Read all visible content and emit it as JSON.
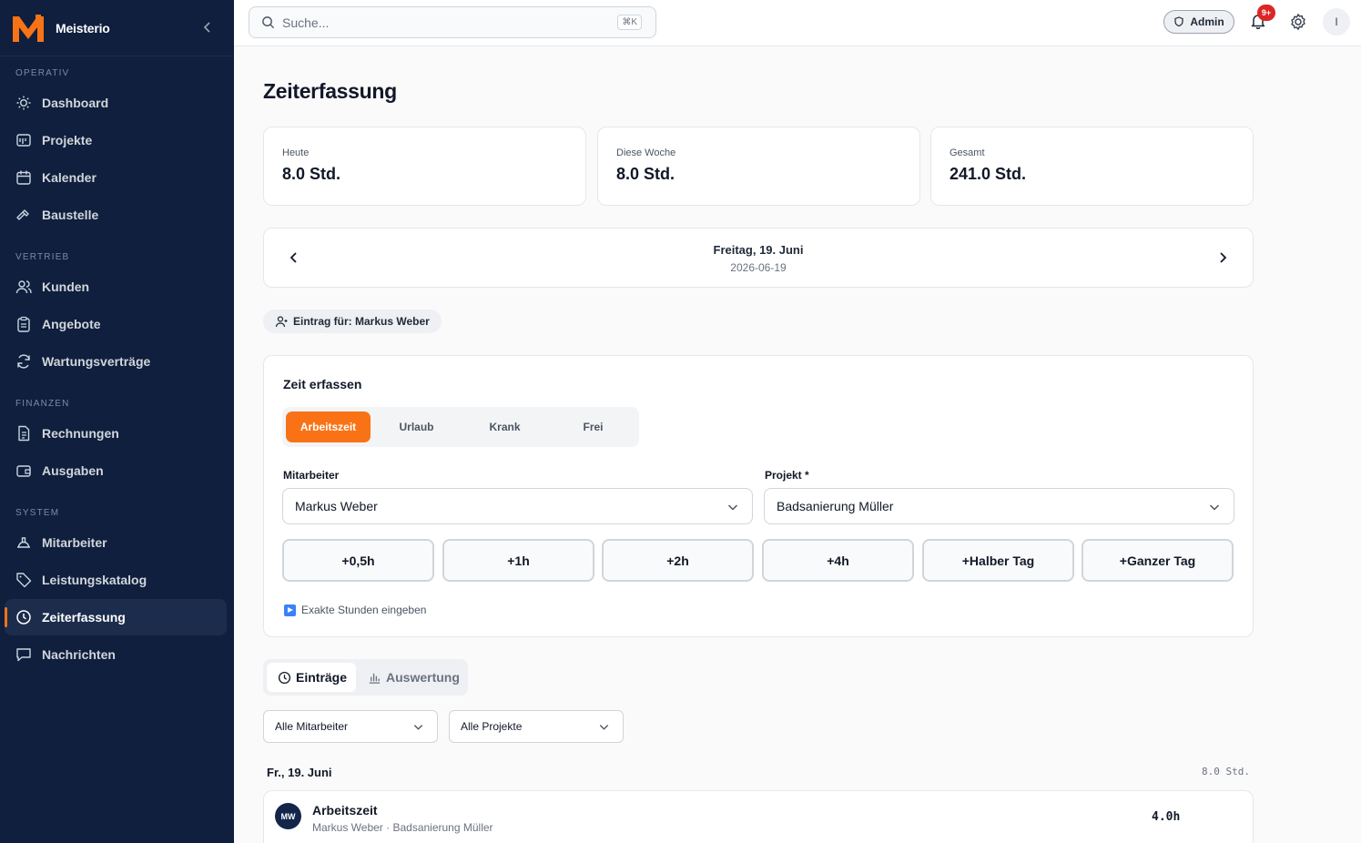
{
  "brand": {
    "name": "Meisterio"
  },
  "sidebar": {
    "sections": [
      "OPERATIV",
      "VERTRIEB",
      "FINANZEN",
      "SYSTEM"
    ],
    "items": [
      {
        "label": "Dashboard",
        "icon": "sun-icon"
      },
      {
        "label": "Projekte",
        "icon": "projects-icon"
      },
      {
        "label": "Kalender",
        "icon": "calendar-icon"
      },
      {
        "label": "Baustelle",
        "icon": "hammer-icon"
      },
      {
        "label": "Kunden",
        "icon": "users-icon"
      },
      {
        "label": "Angebote",
        "icon": "clipboard-icon"
      },
      {
        "label": "Wartungsverträge",
        "icon": "refresh-icon"
      },
      {
        "label": "Rechnungen",
        "icon": "invoice-icon"
      },
      {
        "label": "Ausgaben",
        "icon": "wallet-icon"
      },
      {
        "label": "Mitarbeiter",
        "icon": "hardhat-icon"
      },
      {
        "label": "Leistungskatalog",
        "icon": "tag-icon"
      },
      {
        "label": "Zeiterfassung",
        "icon": "clock-icon",
        "active": true
      },
      {
        "label": "Nachrichten",
        "icon": "message-icon"
      }
    ]
  },
  "topbar": {
    "search_placeholder": "Suche...",
    "shortcut": "⌘K",
    "role": "Admin",
    "notifications": "9+",
    "avatar_initial": "I"
  },
  "page": {
    "title": "Zeiterfassung",
    "stats": [
      {
        "label": "Heute",
        "value": "8.0 Std."
      },
      {
        "label": "Diese Woche",
        "value": "8.0 Std."
      },
      {
        "label": "Gesamt",
        "value": "241.0 Std."
      }
    ],
    "date_nav": {
      "day": "Freitag, 19. Juni",
      "iso": "2026-06-19"
    },
    "entry_for": "Eintrag für: Markus Weber"
  },
  "capture": {
    "title": "Zeit erfassen",
    "types": [
      "Arbeitszeit",
      "Urlaub",
      "Krank",
      "Frei"
    ],
    "active_type": "Arbeitszeit",
    "employee_label": "Mitarbeiter",
    "employee_value": "Markus Weber",
    "project_label": "Projekt *",
    "project_value": "Badsanierung Müller",
    "quick_buttons": [
      "+0,5h",
      "+1h",
      "+2h",
      "+4h",
      "+Halber Tag",
      "+Ganzer Tag"
    ],
    "exact_link": "Exakte Stunden eingeben"
  },
  "list": {
    "tabs": [
      "Einträge",
      "Auswertung"
    ],
    "filters": [
      "Alle Mitarbeiter",
      "Alle Projekte"
    ],
    "group_date": "Fr., 19. Juni",
    "group_total": "8.0 Std.",
    "entries": [
      {
        "initials": "MW",
        "title": "Arbeitszeit",
        "subtitle": "Markus Weber · Badsanierung Müller",
        "hours": "4.0h"
      }
    ]
  },
  "colors": {
    "sidebar": "#0f1f3d",
    "accent": "#f97316",
    "badge": "#dc2626"
  }
}
